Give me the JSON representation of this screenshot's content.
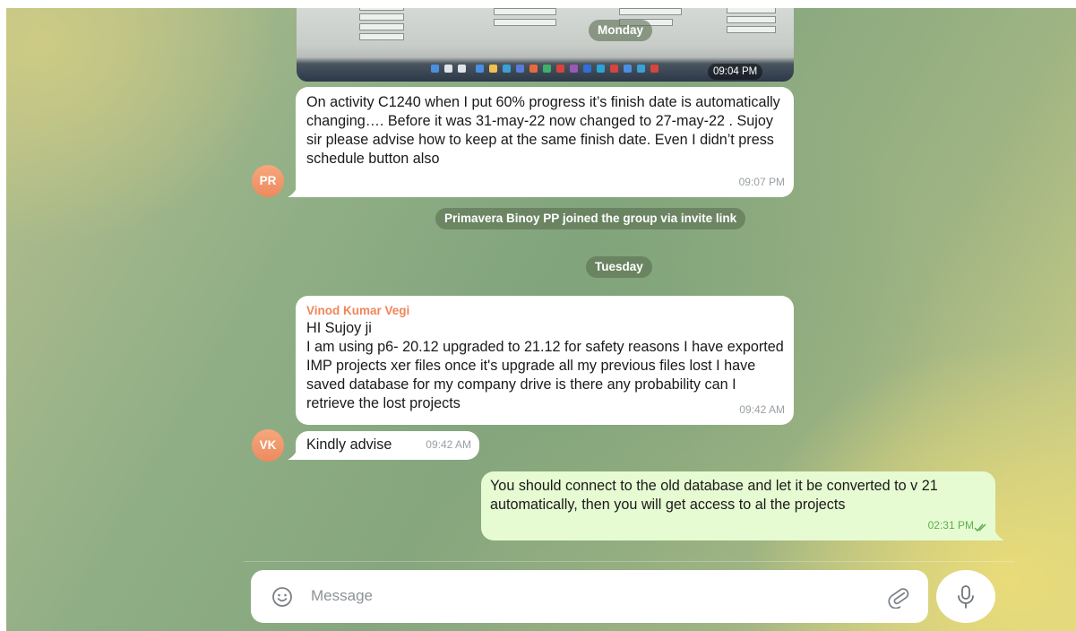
{
  "messages": {
    "image_time": "09:04 PM",
    "day_monday": "Monday",
    "msg1": {
      "avatar": "PR",
      "text": "On activity C1240 when I put 60% progress it’s finish date is automatically changing…. Before it was 31-may-22 now changed to 27-may-22 . Sujoy sir please advise how to keep at the same finish date. Even I didn’t press schedule button also",
      "time": "09:07 PM"
    },
    "service_join": "Primavera Binoy PP joined the group via invite link",
    "day_tuesday": "Tuesday",
    "msg2": {
      "sender": "Vinod Kumar Vegi",
      "text": "HI Sujoy ji\nI am using p6- 20.12 upgraded to 21.12 for safety reasons I have exported IMP projects xer files once it's upgrade all my previous files lost I have saved database for my company drive is there any probability can I retrieve the lost projects",
      "time": "09:42 AM"
    },
    "msg3": {
      "avatar": "VK",
      "text": "Kindly advise",
      "time": "09:42 AM"
    },
    "msg4": {
      "text": "You should connect to the old database and let it be converted to v 21 automatically, then you will get access to al the projects",
      "time": "02:31 PM"
    }
  },
  "composer": {
    "placeholder": "Message"
  },
  "icons": {
    "emoji": "emoji-icon",
    "attach": "paperclip-icon",
    "mic": "microphone-icon",
    "read": "double-check-icon"
  },
  "colors": {
    "sender_name": "#f0855a",
    "outgoing_bubble": "#e6fbd2",
    "outgoing_time": "#5fae52"
  }
}
